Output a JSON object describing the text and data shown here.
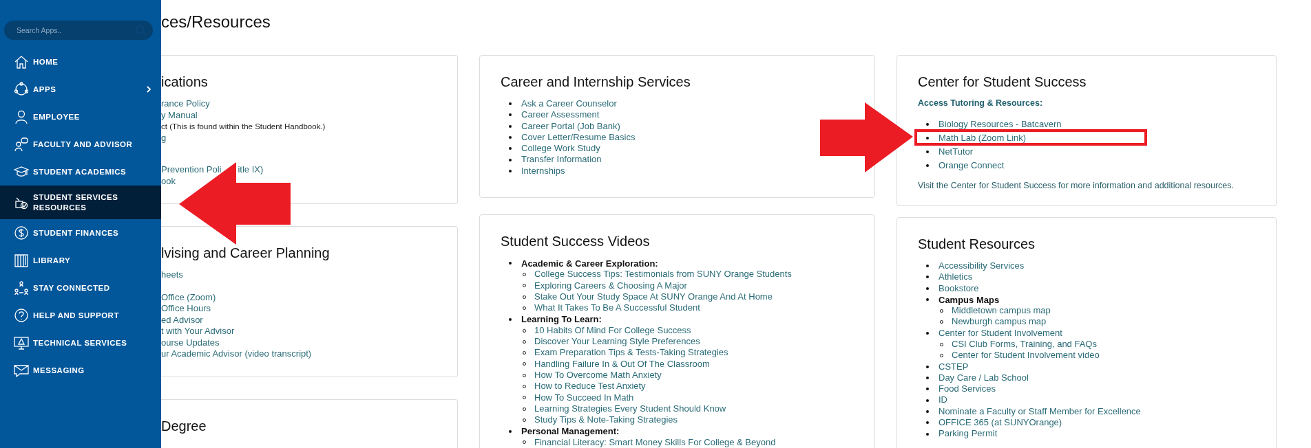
{
  "sidebar": {
    "search": {
      "placeholder": "Search Apps.."
    },
    "items": [
      {
        "label": "HOME",
        "selected": false,
        "expandable": false
      },
      {
        "label": "APPS",
        "selected": false,
        "expandable": true
      },
      {
        "label": "EMPLOYEE",
        "selected": false,
        "expandable": false
      },
      {
        "label": "FACULTY AND ADVISOR",
        "selected": false,
        "expandable": false
      },
      {
        "label": "STUDENT ACADEMICS",
        "selected": false,
        "expandable": false
      },
      {
        "label": "STUDENT SERVICES RESOURCES",
        "selected": true,
        "expandable": false
      },
      {
        "label": "STUDENT FINANCES",
        "selected": false,
        "expandable": false
      },
      {
        "label": "LIBRARY",
        "selected": false,
        "expandable": false
      },
      {
        "label": "STAY CONNECTED",
        "selected": false,
        "expandable": false
      },
      {
        "label": "HELP AND SUPPORT",
        "selected": false,
        "expandable": false
      },
      {
        "label": "TECHNICAL SERVICES",
        "selected": false,
        "expandable": false
      },
      {
        "label": "MESSAGING",
        "selected": false,
        "expandable": false
      }
    ]
  },
  "page_title": "ces/Resources",
  "columns": [
    {
      "cards": [
        {
          "title": "ications",
          "groups": [
            [
              {
                "kind": "link",
                "text": "rance Policy"
              },
              {
                "kind": "link",
                "text": "y Manual"
              },
              {
                "kind": "note",
                "text": "ct (This is found within the Student Handbook.)"
              },
              {
                "kind": "link",
                "text": "g"
              }
            ],
            [
              {
                "kind": "link",
                "text": "Prevention Poli",
                "tail": "itle IX)"
              },
              {
                "kind": "link",
                "text": "ook"
              }
            ]
          ]
        },
        {
          "title": "lvising and Career Planning",
          "groups": [
            [
              {
                "kind": "link",
                "text": "heets"
              }
            ],
            [
              {
                "kind": "link",
                "text": "Office (Zoom)"
              },
              {
                "kind": "link",
                "text": "Office Hours"
              },
              {
                "kind": "link",
                "text": "ed Advisor"
              },
              {
                "kind": "link",
                "text": "t with Your Advisor"
              },
              {
                "kind": "link",
                "text": "ourse Updates"
              },
              {
                "kind": "link",
                "text": "ur Academic Advisor (video transcript)"
              }
            ]
          ]
        },
        {
          "title": "Degree"
        }
      ]
    },
    {
      "cards": [
        {
          "title": "Career and Internship Services",
          "list": [
            {
              "text": "Ask a Career Counselor"
            },
            {
              "text": "Career Assessment"
            },
            {
              "text": "Career Portal (Job Bank)"
            },
            {
              "text": "Cover Letter/Resume Basics"
            },
            {
              "text": "College Work Study"
            },
            {
              "text": "Transfer Information"
            },
            {
              "text": "Internships"
            }
          ]
        },
        {
          "title": "Student Success Videos",
          "list": [
            {
              "text": "Academic & Career Exploration:",
              "heading": true,
              "children": [
                {
                  "text": "College Success Tips: Testimonials from SUNY Orange Students"
                },
                {
                  "text": "Exploring Careers & Choosing A Major"
                },
                {
                  "text": "Stake Out Your Study Space At SUNY Orange And At Home"
                },
                {
                  "text": "What It Takes To Be A Successful Student"
                }
              ]
            },
            {
              "text": "Learning To Learn:",
              "heading": true,
              "children": [
                {
                  "text": "10 Habits Of Mind For College Success"
                },
                {
                  "text": "Discover Your Learning Style Preferences"
                },
                {
                  "text": "Exam Preparation Tips & Tests-Taking Strategies"
                },
                {
                  "text": "Handling Failure In & Out Of The Classroom"
                },
                {
                  "text": "How To Overcome Math Anxiety"
                },
                {
                  "text": "How to Reduce Test Anxiety"
                },
                {
                  "text": "How To Succeed In Math"
                },
                {
                  "text": "Learning Strategies Every Student Should Know"
                },
                {
                  "text": "Study Tips & Note-Taking Strategies"
                }
              ]
            },
            {
              "text": "Personal Management:",
              "heading": true,
              "children": [
                {
                  "text": "Financial Literacy: Smart Money Skills For College & Beyond"
                }
              ]
            }
          ]
        }
      ]
    },
    {
      "cards": [
        {
          "title": "Center for Student Success",
          "subheading": "Access Tutoring & Resources:",
          "list": [
            {
              "text": "Biology Resources - Batcavern"
            },
            {
              "text": "Math Lab (Zoom Link)"
            },
            {
              "text": "NetTutor"
            },
            {
              "text": "Orange Connect"
            }
          ],
          "footer": "Visit the Center for Student Success for more information and additional resources."
        },
        {
          "title": "Student Resources",
          "list": [
            {
              "text": "Accessibility Services"
            },
            {
              "text": "Athletics"
            },
            {
              "text": "Bookstore"
            },
            {
              "text": "Campus Maps",
              "heading": true,
              "children": [
                {
                  "text": "Middletown campus map"
                },
                {
                  "text": "Newburgh campus map"
                }
              ]
            },
            {
              "text": "Center for Student Involvement",
              "children": [
                {
                  "text": "CSI Club Forms, Training, and FAQs"
                },
                {
                  "text": "Center for Student Involvement video"
                }
              ]
            },
            {
              "text": "CSTEP"
            },
            {
              "text": "Day Care / Lab School"
            },
            {
              "text": "Food Services"
            },
            {
              "text": "ID"
            },
            {
              "text": "Nominate a Faculty or Staff Member for Excellence"
            },
            {
              "text": "OFFICE 365 (at SUNYOrange)"
            },
            {
              "text": "Parking Permit"
            }
          ]
        }
      ]
    }
  ]
}
